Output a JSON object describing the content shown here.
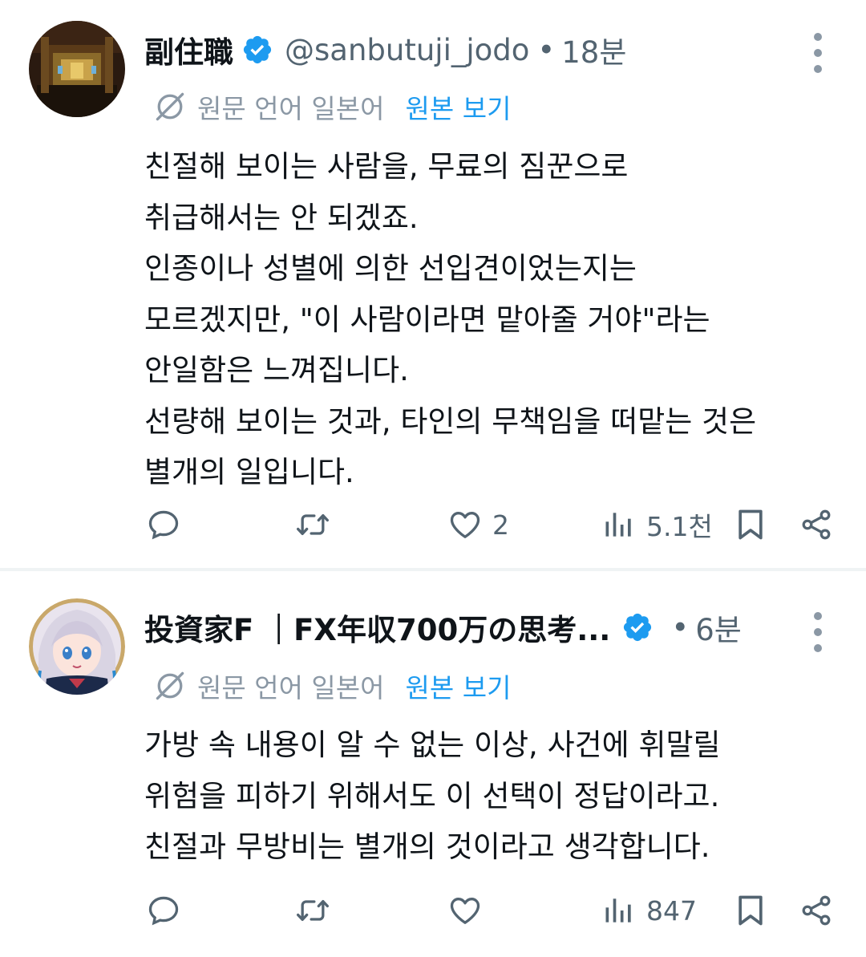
{
  "tweets": [
    {
      "author_name": "副住職",
      "handle": "@sanbutuji_jodo",
      "separator": "•",
      "time": "18분",
      "translate_label": "원문 언어 일본어",
      "translate_link": "원본 보기",
      "lines": [
        "친절해 보이는 사람을, 무료의 짐꾼으로",
        "취급해서는 안 되겠죠.",
        "인종이나 성별에 의한 선입견이었는지는",
        "모르겠지만, \"이 사람이라면 맡아줄 거야\"라는",
        "안일함은 느껴집니다.",
        "선량해 보이는 것과, 타인의 무책임을 떠맡는 것은",
        "별개의 일입니다."
      ],
      "likes": "2",
      "views": "5.1천"
    },
    {
      "author_name": "投資家F ｜FX年収700万の思考...",
      "separator": "•",
      "time": "6분",
      "translate_label": "원문 언어 일본어",
      "translate_link": "원본 보기",
      "lines": [
        "가방 속 내용이 알 수 없는 이상, 사건에 휘말릴",
        "위험을 피하기 위해서도 이 선택이 정답이라고.",
        "친절과 무방비는 별개의 것이라고 생각합니다."
      ],
      "likes": "",
      "views": "847"
    }
  ],
  "colors": {
    "text": "#0f1419",
    "secondary": "#536471",
    "accent": "#1d9bf0",
    "divider": "#eff3f4"
  },
  "icons": [
    "verified-badge-icon",
    "more-icon",
    "translate-icon",
    "reply-icon",
    "retweet-icon",
    "like-icon",
    "views-icon",
    "bookmark-icon",
    "share-icon"
  ]
}
